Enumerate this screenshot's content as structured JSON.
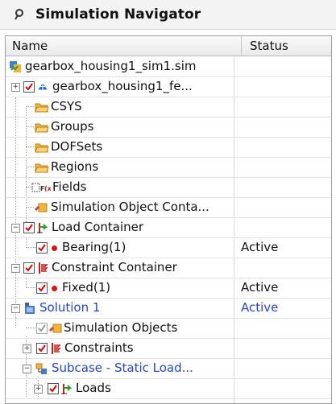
{
  "panel": {
    "title": "Simulation Navigator"
  },
  "columns": {
    "name": "Name",
    "status": "Status"
  },
  "rows": [
    {
      "label": "gearbox_housing1_sim1.sim",
      "status": ""
    },
    {
      "label": "gearbox_housing1_fe...",
      "status": ""
    },
    {
      "label": "CSYS",
      "status": ""
    },
    {
      "label": "Groups",
      "status": ""
    },
    {
      "label": "DOFSets",
      "status": ""
    },
    {
      "label": "Regions",
      "status": ""
    },
    {
      "label": "Fields",
      "status": ""
    },
    {
      "label": "Simulation Object Conta...",
      "status": ""
    },
    {
      "label": "Load Container",
      "status": ""
    },
    {
      "label": "Bearing(1)",
      "status": "Active"
    },
    {
      "label": "Constraint Container",
      "status": ""
    },
    {
      "label": "Fixed(1)",
      "status": "Active"
    },
    {
      "label": "Solution 1",
      "status": "Active"
    },
    {
      "label": "Simulation Objects",
      "status": ""
    },
    {
      "label": "Constraints",
      "status": ""
    },
    {
      "label": "Subcase - Static Load...",
      "status": ""
    },
    {
      "label": "Loads",
      "status": ""
    }
  ],
  "colors": {
    "link_blue": "#2346c8",
    "folder": "#f0b43a",
    "check_red": "#e00000",
    "load_green": "#2aa02a"
  }
}
